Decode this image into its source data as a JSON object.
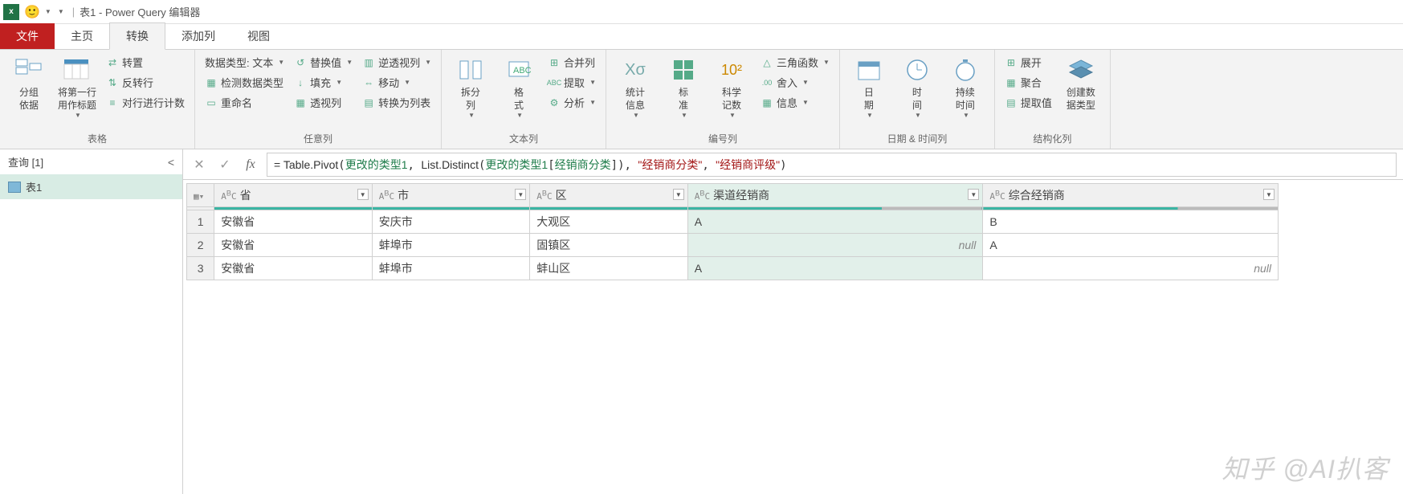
{
  "titlebar": {
    "title": "表1 - Power Query 编辑器"
  },
  "tabs": {
    "file": "文件",
    "home": "主页",
    "transform": "转换",
    "addcol": "添加列",
    "view": "视图"
  },
  "ribbon": {
    "groupTable": {
      "groupLabel": "表格",
      "groupBy": "分组\n依据",
      "firstRowHeader": "将第一行\n用作标题",
      "transpose": "转置",
      "reverseRows": "反转行",
      "countRows": "对行进行计数"
    },
    "groupAnyCol": {
      "groupLabel": "任意列",
      "dataType": "数据类型: 文本",
      "detectType": "检测数据类型",
      "rename": "重命名",
      "replace": "替换值",
      "fill": "填充",
      "pivot": "透视列",
      "unpivot": "逆透视列",
      "move": "移动",
      "toList": "转换为列表"
    },
    "groupTextCol": {
      "groupLabel": "文本列",
      "split": "拆分\n列",
      "format": "格\n式",
      "merge": "合并列",
      "extract": "提取",
      "parse": "分析"
    },
    "groupNumCol": {
      "groupLabel": "编号列",
      "stats": "统计\n信息",
      "standard": "标\n准",
      "scientific": "科学\n记数",
      "trig": "三角函数",
      "round": "舍入",
      "info": "信息"
    },
    "groupDate": {
      "groupLabel": "日期 & 时间列",
      "date": "日\n期",
      "time": "时\n间",
      "duration": "持续\n时间"
    },
    "groupStruct": {
      "groupLabel": "结构化列",
      "expand": "展开",
      "aggregate": "聚合",
      "extractVal": "提取值",
      "createType": "创建数\n据类型"
    }
  },
  "queriesPane": {
    "header": "查询 [1]",
    "item": "表1"
  },
  "formula": {
    "prefix": "= ",
    "fn1": "Table.Pivot",
    "arg1": "更改的类型1",
    "fn2": "List.Distinct",
    "arg2a": "更改的类型1",
    "arg2b": "经销商分类",
    "str1": "\"经销商分类\"",
    "str2": "\"经销商评级\""
  },
  "gridHeaders": [
    "省",
    "市",
    "区",
    "渠道经销商",
    "综合经销商"
  ],
  "gridRows": [
    {
      "n": "1",
      "cells": [
        "安徽省",
        "安庆市",
        "大观区",
        "A",
        "B"
      ],
      "hl": [
        3
      ]
    },
    {
      "n": "2",
      "cells": [
        "安徽省",
        "蚌埠市",
        "固镇区",
        null,
        "A"
      ],
      "hl": [
        3
      ]
    },
    {
      "n": "3",
      "cells": [
        "安徽省",
        "蚌埠市",
        "蚌山区",
        "A",
        null
      ],
      "hl": [
        3
      ]
    }
  ],
  "nullText": "null",
  "watermark": "知乎 @AI扒客"
}
